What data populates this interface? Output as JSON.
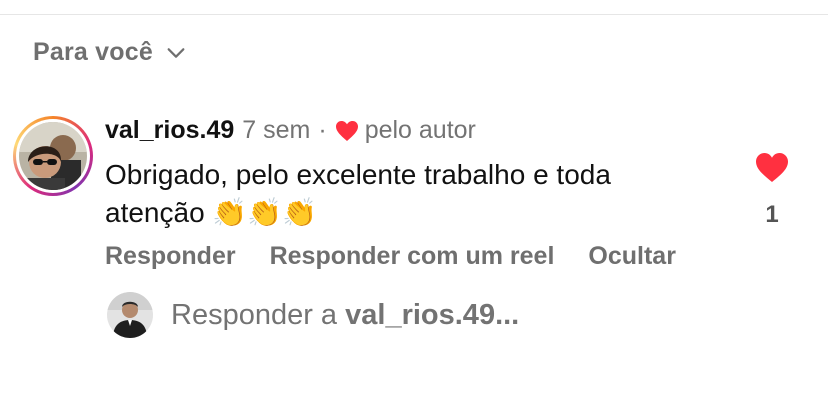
{
  "sort": {
    "label": "Para você",
    "icon": "chevron-down-icon"
  },
  "comment": {
    "username": "val_rios.49",
    "time": "7 sem",
    "separator": "·",
    "liked_by_author_label": "pelo autor",
    "text": "Obrigado, pelo excelente trabalho e toda atenção",
    "emoji": [
      "👏",
      "👏",
      "👏"
    ],
    "like_count": "1",
    "liked": true,
    "heart_color": "#ff3040"
  },
  "actions": {
    "reply": "Responder",
    "reply_with_reel": "Responder com um reel",
    "hide": "Ocultar"
  },
  "reply_box": {
    "prefix": "Responder a",
    "target": "val_rios.49..."
  },
  "colors": {
    "secondary_text": "#737373",
    "primary_text": "#111111",
    "accent_heart": "#ff3040"
  }
}
